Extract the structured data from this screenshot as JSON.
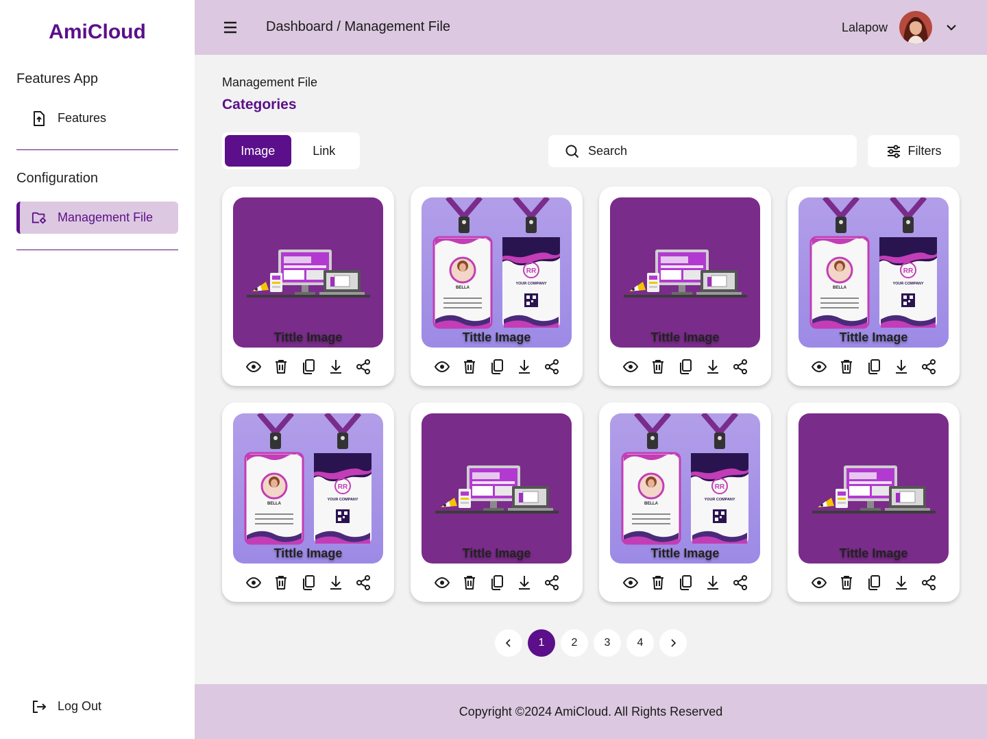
{
  "brand": {
    "name": "AmiCloud",
    "accent": "#5b0f8a",
    "header_bg": "#dcc8e0"
  },
  "sidebar": {
    "section1_title": "Features App",
    "features_label": "Features",
    "section2_title": "Configuration",
    "management_label": "Management File",
    "logout_label": "Log Out"
  },
  "header": {
    "breadcrumb_root": "Dashboard",
    "breadcrumb_sep": " / ",
    "breadcrumb_current": "Management File",
    "username": "Lalapow"
  },
  "main": {
    "page_label": "Management File",
    "page_title": "Categories",
    "tabs": [
      {
        "label": "Image",
        "active": true
      },
      {
        "label": "Link",
        "active": false
      }
    ],
    "search_placeholder": "Search",
    "filters_label": "Filters",
    "cards": [
      {
        "title": "Tittle Image",
        "art": "devices"
      },
      {
        "title": "Tittle Image",
        "art": "idcard"
      },
      {
        "title": "Tittle Image",
        "art": "devices"
      },
      {
        "title": "Tittle Image",
        "art": "idcard"
      },
      {
        "title": "Tittle Image",
        "art": "idcard"
      },
      {
        "title": "Tittle Image",
        "art": "devices"
      },
      {
        "title": "Tittle Image",
        "art": "idcard"
      },
      {
        "title": "Tittle Image",
        "art": "devices"
      }
    ],
    "card_actions": [
      "eye-icon",
      "trash-icon",
      "copy-icon",
      "download-icon",
      "share-icon"
    ]
  },
  "pagination": {
    "pages": [
      "1",
      "2",
      "3",
      "4"
    ],
    "current": "1"
  },
  "footer": {
    "text": "Copyright ©2024 AmiCloud. All Rights Reserved"
  }
}
